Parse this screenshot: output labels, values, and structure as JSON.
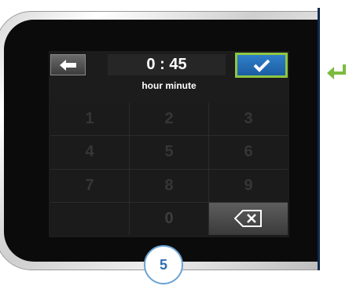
{
  "screen": {
    "back_icon": "left-arrow-icon",
    "time_value": "0 : 45",
    "time_units": "hour  minute",
    "confirm_icon": "checkmark-icon",
    "keypad": {
      "keys": [
        "1",
        "2",
        "3",
        "4",
        "5",
        "6",
        "7",
        "8",
        "9",
        "",
        "0",
        "backspace"
      ],
      "backspace_icon": "backspace-x-icon"
    }
  },
  "annotations": {
    "step_number": "5",
    "return_icon": "return-arrow-icon"
  },
  "colors": {
    "confirm_border": "#8fc643",
    "confirm_fill": "#1c5ea3",
    "step_text": "#2f6fb0",
    "return_arrow": "#7dbb3f"
  }
}
